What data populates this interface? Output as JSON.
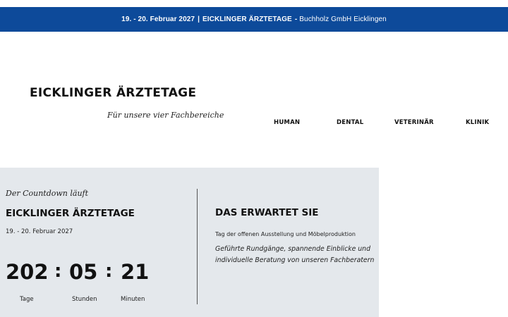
{
  "topbar": {
    "date": "19. - 20. Februar 2027",
    "separator": "|",
    "event": "EICKLINGER ÄRZTETAGE",
    "dash": "-",
    "location": "Buchholz GmbH Eicklingen"
  },
  "brand": {
    "title": "EICKLINGER ÄRZTETAGE",
    "tagline": "Für unsere vier Fachbereiche"
  },
  "nav": {
    "items": [
      {
        "label": "HUMAN"
      },
      {
        "label": "DENTAL"
      },
      {
        "label": "VETERINÄR"
      },
      {
        "label": "KLINIK"
      }
    ]
  },
  "countdown": {
    "kicker": "Der Countdown läuft",
    "title": "EICKLINGER ÄRZTETAGE",
    "date": "19. - 20. Februar 2027",
    "days": "202",
    "hours": "05",
    "minutes": "21",
    "separator": ":",
    "days_label": "Tage",
    "hours_label": "Stunden",
    "minutes_label": "Minuten"
  },
  "expect": {
    "title": "DAS ERWARTET SIE",
    "subtitle": "Tag der offenen Ausstellung und Möbelproduktion",
    "description": "Geführte Rundgänge, spannende Einblicke und individuelle Beratung von unseren Fachberatern"
  },
  "colors": {
    "topbar_bg": "#0d4a9a",
    "panel_bg": "#e4e8ec"
  }
}
